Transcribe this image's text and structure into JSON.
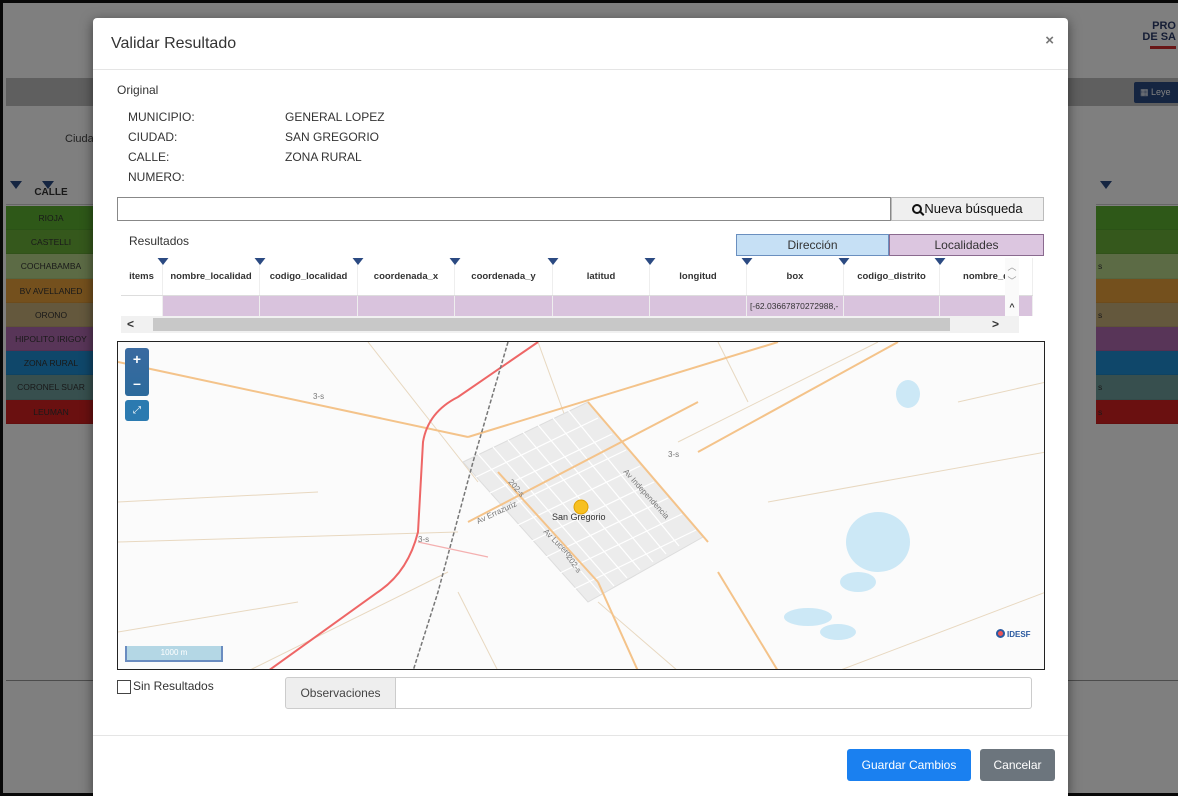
{
  "background": {
    "logo_line1": "PRO",
    "logo_line2": "DE SA",
    "legend_button": "Leye",
    "filter_label": "Ciuda",
    "column_header": "CALLE",
    "rows": [
      {
        "label": "RIOJA",
        "color": "#5cb031"
      },
      {
        "label": "CASTELLI",
        "color": "#6ab038"
      },
      {
        "label": "COCHABAMBA",
        "color": "#b8d68a"
      },
      {
        "label": "BV AVELLANED",
        "color": "#e8a03a"
      },
      {
        "label": "ORONO",
        "color": "#c9b07a"
      },
      {
        "label": "HIPOLITO IRIGOY",
        "color": "#b06ab0"
      },
      {
        "label": "ZONA RURAL",
        "color": "#1f8fd4"
      },
      {
        "label": "CORONEL SUAR",
        "color": "#6e9e9c"
      },
      {
        "label": "LEUMAN",
        "color": "#d42020"
      }
    ],
    "right_row_texts": [
      "",
      "",
      "s",
      "",
      "s",
      "",
      "",
      "s",
      "s"
    ]
  },
  "modal": {
    "title": "Validar Resultado",
    "close": "×",
    "original_label": "Original",
    "original": [
      {
        "key": "MUNICIPIO:",
        "value": "GENERAL LOPEZ"
      },
      {
        "key": "CIUDAD:",
        "value": "SAN GREGORIO"
      },
      {
        "key": "CALLE:",
        "value": "ZONA RURAL"
      },
      {
        "key": "NUMERO:",
        "value": ""
      }
    ],
    "search": {
      "value": "",
      "button_label": "Nueva búsqueda"
    },
    "results_label": "Resultados",
    "tabs": {
      "direccion": "Dirección",
      "localidades": "Localidades"
    },
    "grid": {
      "columns": [
        "items",
        "nombre_localidad",
        "codigo_localidad",
        "coordenada_x",
        "coordenada_y",
        "latitud",
        "longitud",
        "box",
        "codigo_distrito",
        "nombre_d"
      ],
      "row": [
        "",
        "",
        "",
        "",
        "",
        "",
        "",
        "[-62.03667870272988,-",
        "",
        ""
      ]
    },
    "map": {
      "zoom_in": "+",
      "zoom_out": "–",
      "fullscreen": "⤢",
      "scale": "1000 m",
      "attribution": "IDESF",
      "place_label": "San Gregorio",
      "street_labels": [
        "3-s",
        "3-s",
        "3-s",
        "202-s",
        "Av Independencia",
        "Av Errazuriz",
        "Av Lucero",
        "202-s"
      ]
    },
    "sin_resultados": "Sin Resultados",
    "observaciones": {
      "label": "Observaciones",
      "value": ""
    },
    "buttons": {
      "save": "Guardar Cambios",
      "cancel": "Cancelar"
    }
  }
}
